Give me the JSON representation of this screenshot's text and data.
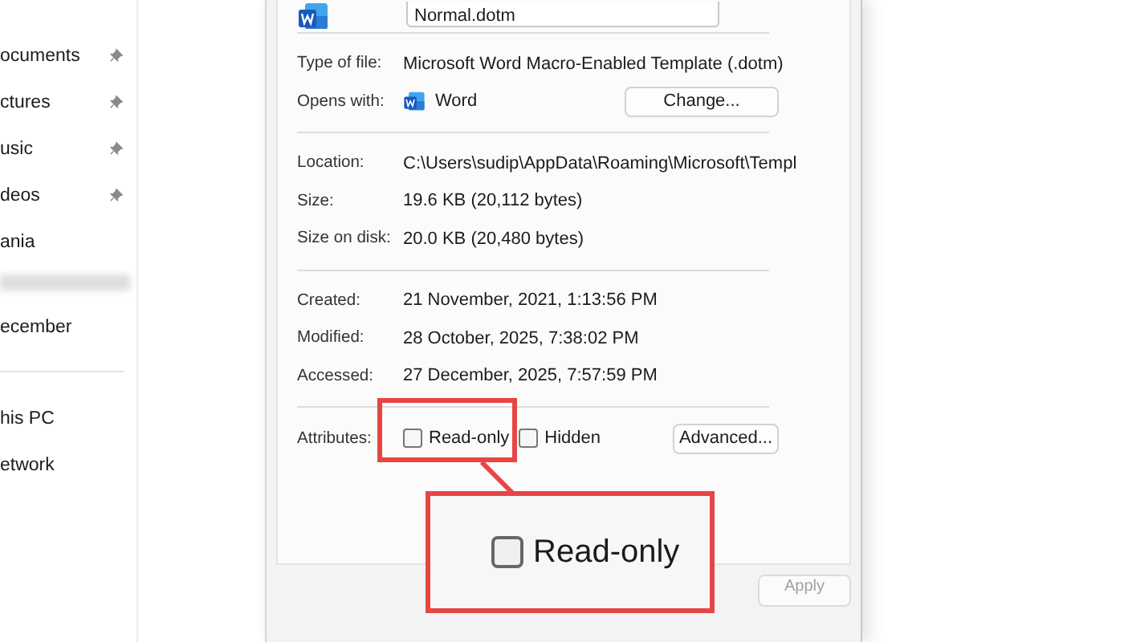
{
  "sidebar": {
    "items": [
      {
        "label": "ocuments",
        "pinned": true,
        "kind": "item"
      },
      {
        "label": "ctures",
        "pinned": true,
        "kind": "item"
      },
      {
        "label": "usic",
        "pinned": true,
        "kind": "item"
      },
      {
        "label": "deos",
        "pinned": true,
        "kind": "item"
      },
      {
        "label": "ania",
        "pinned": false,
        "kind": "item"
      },
      {
        "kind": "redacted"
      },
      {
        "label": "ecember",
        "pinned": false,
        "kind": "item"
      },
      {
        "kind": "divider"
      },
      {
        "label": "his PC",
        "pinned": false,
        "kind": "item"
      },
      {
        "label": "etwork",
        "pinned": false,
        "kind": "item"
      }
    ]
  },
  "dialog": {
    "file_name": "Normal.dotm",
    "sections": [
      {
        "rows": [
          {
            "label": "Type of file:",
            "value": "Microsoft Word Macro-Enabled Template (.dotm)",
            "kind": "text"
          },
          {
            "label": "Opens with:",
            "value": "Word",
            "kind": "app",
            "button": "Change..."
          }
        ]
      },
      {
        "rows": [
          {
            "label": "Location:",
            "value": "C:\\Users\\sudip\\AppData\\Roaming\\Microsoft\\Templ",
            "kind": "text"
          },
          {
            "label": "Size:",
            "value": "19.6 KB (20,112 bytes)",
            "kind": "text"
          },
          {
            "label": "Size on disk:",
            "value": "20.0 KB (20,480 bytes)",
            "kind": "text"
          }
        ]
      },
      {
        "rows": [
          {
            "label": "Created:",
            "value": "21 November, 2021, 1:13:56 PM",
            "kind": "text"
          },
          {
            "label": "Modified:",
            "value": "28 October, 2025, 7:38:02 PM",
            "kind": "text"
          },
          {
            "label": "Accessed:",
            "value": "27 December, 2025, 7:57:59 PM",
            "kind": "text"
          }
        ]
      }
    ],
    "attributes": {
      "label": "Attributes:",
      "checkboxes": [
        {
          "label": "Read-only",
          "checked": false
        },
        {
          "label": "Hidden",
          "checked": false
        }
      ],
      "button": "Advanced..."
    },
    "apply": {
      "label": "Apply",
      "disabled": true
    }
  },
  "callout": {
    "label": "Read-only",
    "checked": false
  }
}
